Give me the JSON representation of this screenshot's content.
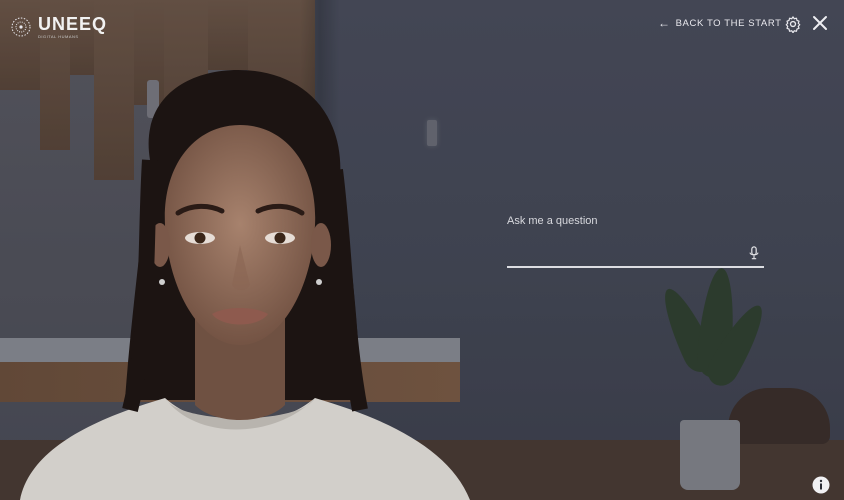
{
  "brand": {
    "logo_text": "UNEEQ",
    "logo_subtext": "DIGITAL HUMANS"
  },
  "header": {
    "back_label": "BACK TO THE START",
    "back_icon": "arrow-left-icon",
    "settings_icon": "gear-icon",
    "close_icon": "close-icon"
  },
  "question": {
    "label": "Ask me a question",
    "value": "",
    "mic_icon": "microphone-icon"
  },
  "footer": {
    "info_icon": "info-icon"
  },
  "colors": {
    "ui_text": "#e9e9ee",
    "underline": "#dcdde2",
    "overlay": "#1e2029"
  }
}
